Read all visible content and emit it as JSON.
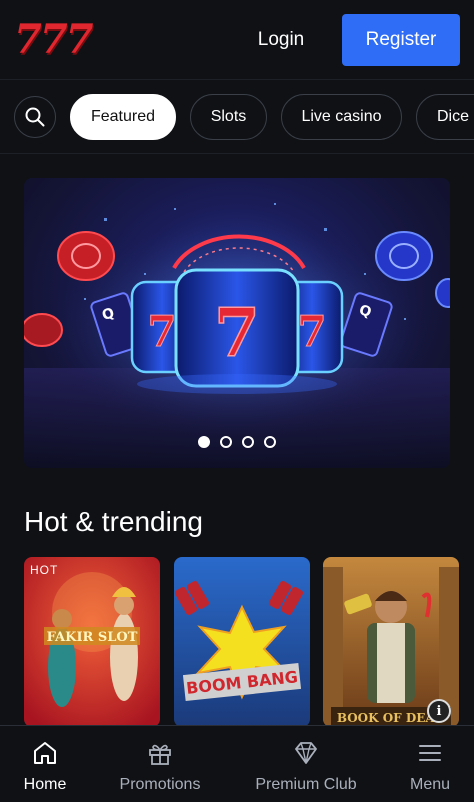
{
  "header": {
    "logo_text": "777",
    "login_label": "Login",
    "register_label": "Register"
  },
  "categories": {
    "search_icon": "search-icon",
    "items": [
      {
        "label": "Featured",
        "active": true
      },
      {
        "label": "Slots",
        "active": false
      },
      {
        "label": "Live casino",
        "active": false
      },
      {
        "label": "Dice",
        "active": false
      }
    ]
  },
  "banner": {
    "slides_total": 4,
    "active_slide": 1
  },
  "hot_trending": {
    "title": "Hot & trending",
    "games": [
      {
        "badge": "HOT",
        "name_art": "FAKIR SLOT"
      },
      {
        "badge": "",
        "name_art": "BOOM BANG"
      },
      {
        "badge": "",
        "name_art": "BOOK OF DEAD"
      }
    ]
  },
  "bottom_nav": {
    "items": [
      {
        "label": "Home",
        "icon": "home-icon",
        "active": true
      },
      {
        "label": "Promotions",
        "icon": "gift-icon",
        "active": false
      },
      {
        "label": "Premium Club",
        "icon": "diamond-icon",
        "active": false
      },
      {
        "label": "Menu",
        "icon": "menu-icon",
        "active": false
      }
    ]
  },
  "colors": {
    "background": "#0f1115",
    "accent_blue": "#2f6df6",
    "logo_red": "#e0262e"
  }
}
